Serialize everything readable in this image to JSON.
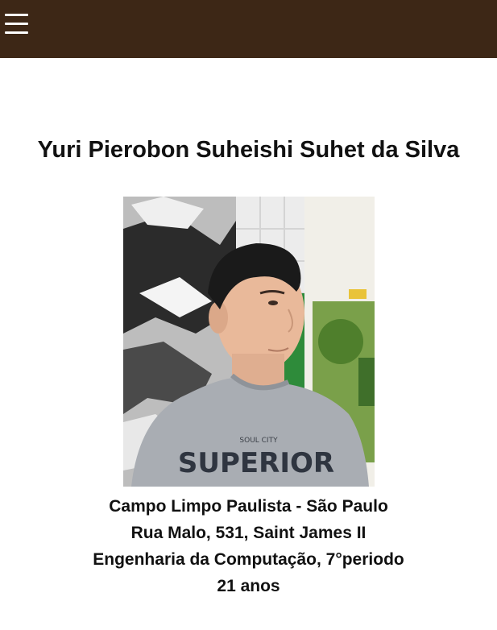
{
  "header": {
    "menu_icon": "hamburger-menu-icon",
    "background_color": "#3d2716"
  },
  "profile": {
    "name": "Yuri Pierobon Suheishi Suhet da Silva",
    "photo": {
      "shirt_text_small": "SOUL CITY",
      "shirt_text_large": "SUPERIOR"
    },
    "city": "Campo Limpo Paulista - São Paulo",
    "address": "Rua Malo, 531, Saint James II",
    "course": "Engenharia da Computação, 7°periodo",
    "age": "21 anos"
  }
}
